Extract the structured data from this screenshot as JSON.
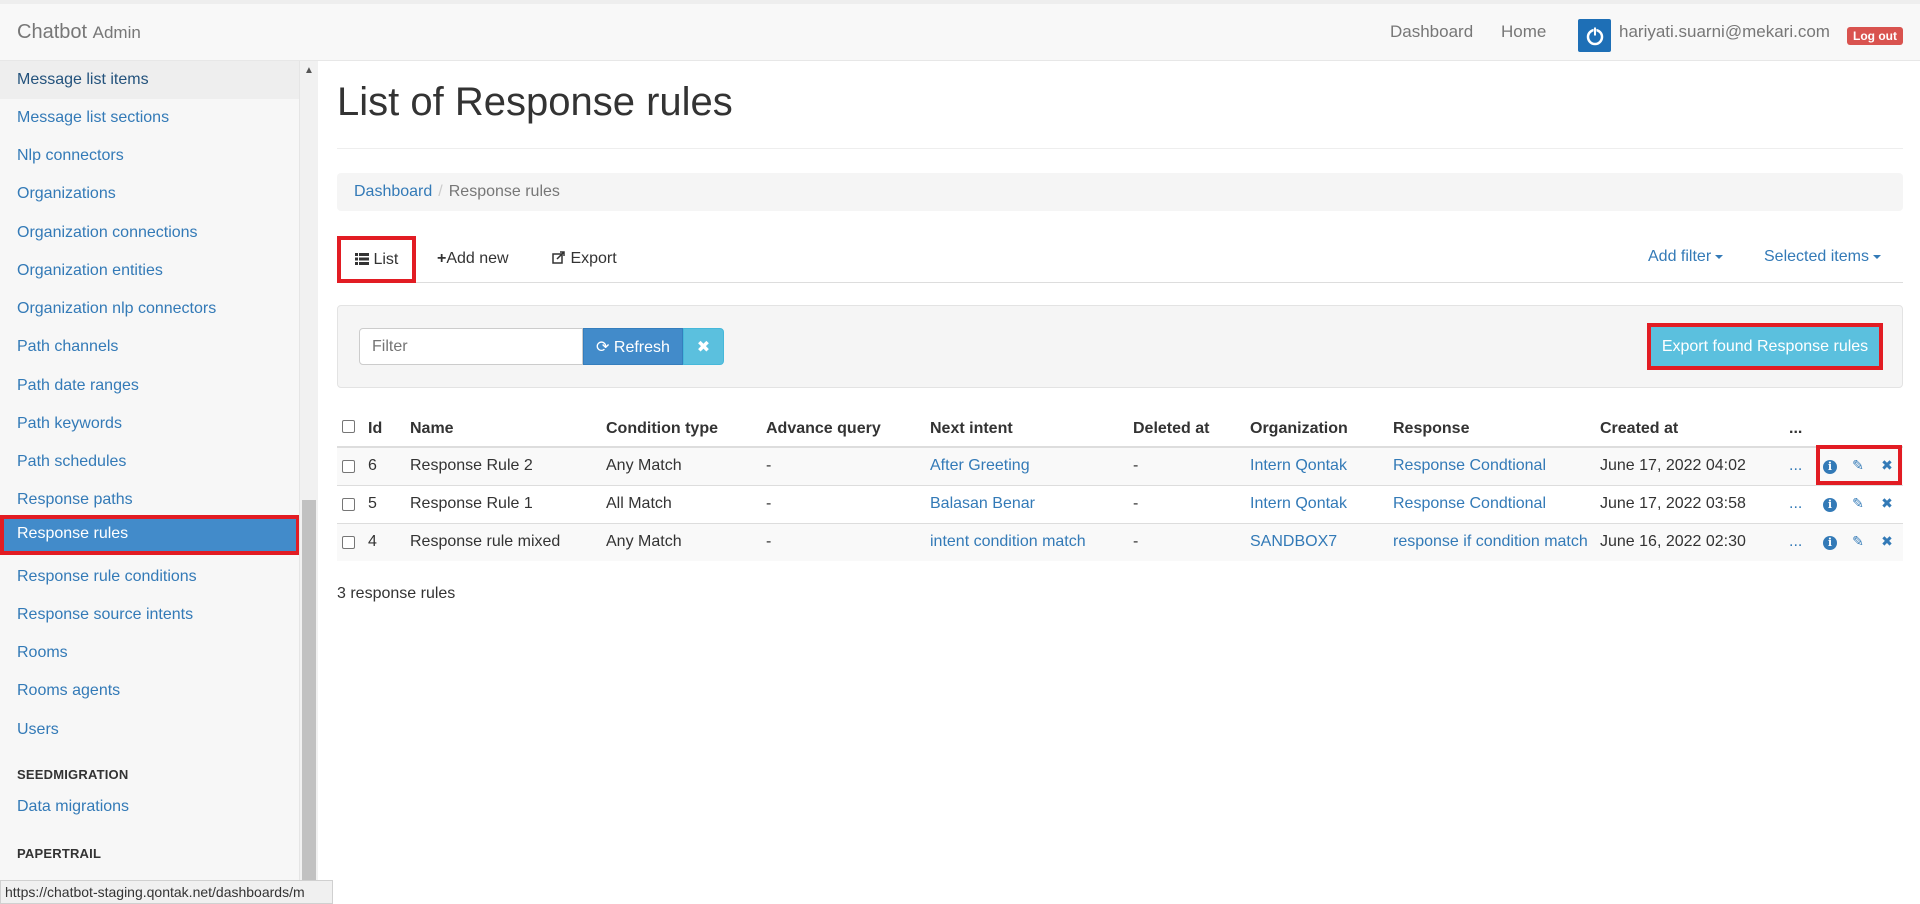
{
  "navbar": {
    "brand": "Chatbot",
    "brand_sub": "Admin",
    "links": [
      "Dashboard",
      "Home"
    ],
    "user_email": "hariyati.suarni@mekari.com",
    "logout": "Log out"
  },
  "sidebar": {
    "items": [
      "Message list items",
      "Message list sections",
      "Nlp connectors",
      "Organizations",
      "Organization connections",
      "Organization entities",
      "Organization nlp connectors",
      "Path channels",
      "Path date ranges",
      "Path keywords",
      "Path schedules",
      "Response paths",
      "Response rules",
      "Response rule conditions",
      "Response source intents",
      "Rooms",
      "Rooms agents",
      "Users"
    ],
    "active": "Response rules",
    "sections": [
      {
        "header": "SEEDMIGRATION",
        "items": [
          "Data migrations"
        ]
      },
      {
        "header": "PAPERTRAIL",
        "items": []
      }
    ]
  },
  "status_url": "https://chatbot-staging.qontak.net/dashboards/m",
  "page": {
    "title": "List of Response rules",
    "breadcrumb": {
      "parent": "Dashboard",
      "current": "Response rules"
    }
  },
  "tabs": {
    "list": "List",
    "add_new": "Add new",
    "export": "Export",
    "add_filter": "Add filter",
    "selected_items": "Selected items"
  },
  "filter": {
    "placeholder": "Filter",
    "refresh": "Refresh",
    "export_found": "Export found Response rules"
  },
  "table": {
    "columns": [
      "Id",
      "Name",
      "Condition type",
      "Advance query",
      "Next intent",
      "Deleted at",
      "Organization",
      "Response",
      "Created at",
      "..."
    ],
    "rows": [
      {
        "id": "6",
        "name": "Response Rule 2",
        "condition_type": "Any Match",
        "advance_query": "-",
        "next_intent": "After Greeting",
        "deleted_at": "-",
        "organization": "Intern Qontak",
        "response": "Response Condtional",
        "created_at": "June 17, 2022 04:02",
        "more": "..."
      },
      {
        "id": "5",
        "name": "Response Rule 1",
        "condition_type": "All Match",
        "advance_query": "-",
        "next_intent": "Balasan Benar",
        "deleted_at": "-",
        "organization": "Intern Qontak",
        "response": "Response Condtional",
        "created_at": "June 17, 2022 03:58",
        "more": "..."
      },
      {
        "id": "4",
        "name": "Response rule mixed",
        "condition_type": "Any Match",
        "advance_query": "-",
        "next_intent": "intent condition match",
        "deleted_at": "-",
        "organization": "SANDBOX7",
        "response": "response if condition match",
        "created_at": "June 16, 2022 02:30",
        "more": "..."
      }
    ],
    "count_label": "3 response rules"
  },
  "colors": {
    "brand_blue": "#337ab7",
    "active_bg": "#428bca",
    "highlight_red": "#e21c23",
    "info": "#5bc0de",
    "danger": "#d9534f"
  },
  "icons": {
    "list": "list-icon",
    "plus": "plus-icon",
    "export": "share-icon",
    "refresh": "refresh-icon",
    "clear": "close-icon",
    "info": "info-icon",
    "edit": "pencil-icon",
    "delete": "close-icon",
    "user": "power-icon"
  }
}
